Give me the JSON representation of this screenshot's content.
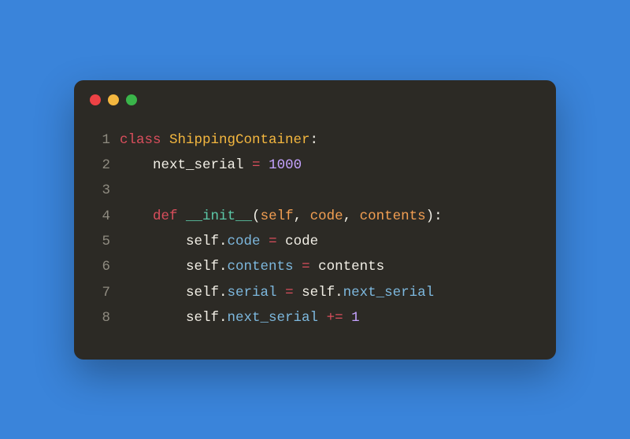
{
  "window": {
    "traffic_lights": [
      "red",
      "yellow",
      "green"
    ]
  },
  "code": {
    "lines": [
      {
        "n": "1",
        "tokens": [
          {
            "t": "class ",
            "c": "kw"
          },
          {
            "t": "ShippingContainer",
            "c": "cls"
          },
          {
            "t": ":",
            "c": "str"
          }
        ]
      },
      {
        "n": "2",
        "tokens": [
          {
            "t": "    next_serial ",
            "c": "str"
          },
          {
            "t": "=",
            "c": "kw"
          },
          {
            "t": " ",
            "c": "str"
          },
          {
            "t": "1000",
            "c": "num"
          }
        ]
      },
      {
        "n": "3",
        "tokens": []
      },
      {
        "n": "4",
        "tokens": [
          {
            "t": "    ",
            "c": "str"
          },
          {
            "t": "def ",
            "c": "kw"
          },
          {
            "t": "__init__",
            "c": "fn"
          },
          {
            "t": "(",
            "c": "str"
          },
          {
            "t": "self",
            "c": "param"
          },
          {
            "t": ", ",
            "c": "str"
          },
          {
            "t": "code",
            "c": "param"
          },
          {
            "t": ", ",
            "c": "str"
          },
          {
            "t": "contents",
            "c": "param"
          },
          {
            "t": "):",
            "c": "str"
          }
        ]
      },
      {
        "n": "5",
        "tokens": [
          {
            "t": "        self.",
            "c": "str"
          },
          {
            "t": "code",
            "c": "prop"
          },
          {
            "t": " ",
            "c": "str"
          },
          {
            "t": "=",
            "c": "kw"
          },
          {
            "t": " code",
            "c": "str"
          }
        ]
      },
      {
        "n": "6",
        "tokens": [
          {
            "t": "        self.",
            "c": "str"
          },
          {
            "t": "contents",
            "c": "prop"
          },
          {
            "t": " ",
            "c": "str"
          },
          {
            "t": "=",
            "c": "kw"
          },
          {
            "t": " contents",
            "c": "str"
          }
        ]
      },
      {
        "n": "7",
        "tokens": [
          {
            "t": "        self.",
            "c": "str"
          },
          {
            "t": "serial",
            "c": "prop"
          },
          {
            "t": " ",
            "c": "str"
          },
          {
            "t": "=",
            "c": "kw"
          },
          {
            "t": " self.",
            "c": "str"
          },
          {
            "t": "next_serial",
            "c": "prop"
          }
        ]
      },
      {
        "n": "8",
        "tokens": [
          {
            "t": "        self.",
            "c": "str"
          },
          {
            "t": "next_serial",
            "c": "prop"
          },
          {
            "t": " ",
            "c": "str"
          },
          {
            "t": "+=",
            "c": "kw"
          },
          {
            "t": " ",
            "c": "str"
          },
          {
            "t": "1",
            "c": "num"
          }
        ]
      }
    ]
  }
}
